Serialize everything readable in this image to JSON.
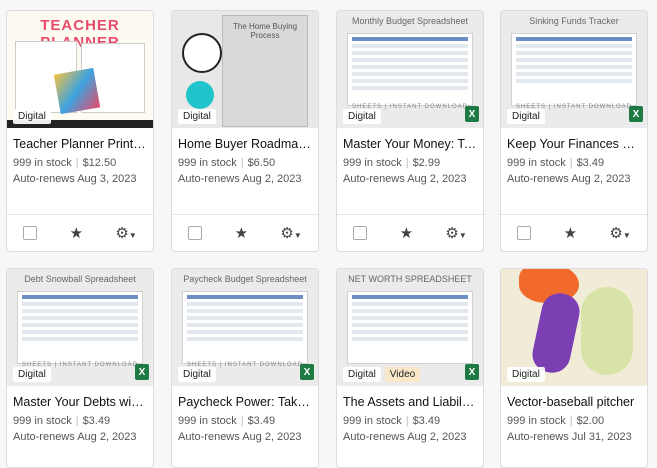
{
  "listings": [
    {
      "title": "Teacher Planner Printa…",
      "stock": "999 in stock",
      "price": "$12.50",
      "renew": "Auto-renews Aug 3, 2023",
      "badges": [
        "Digital"
      ],
      "thumb_text": "TEACHER PLANNER",
      "excel": false
    },
    {
      "title": "Home Buyer Roadmap,…",
      "stock": "999 in stock",
      "price": "$6.50",
      "renew": "Auto-renews Aug 2, 2023",
      "badges": [
        "Digital"
      ],
      "thumb_text": "The Home Buying Process",
      "excel": false
    },
    {
      "title": "Master Your Money: Ta…",
      "stock": "999 in stock",
      "price": "$2.99",
      "renew": "Auto-renews Aug 2, 2023",
      "badges": [
        "Digital"
      ],
      "thumb_text": "Monthly Budget Spreadsheet",
      "excel": true
    },
    {
      "title": "Keep Your Finances on…",
      "stock": "999 in stock",
      "price": "$3.49",
      "renew": "Auto-renews Aug 2, 2023",
      "badges": [
        "Digital"
      ],
      "thumb_text": "Sinking Funds Tracker",
      "excel": true
    },
    {
      "title": "Master Your Debts wit…",
      "stock": "999 in stock",
      "price": "$3.49",
      "renew": "Auto-renews Aug 2, 2023",
      "badges": [
        "Digital"
      ],
      "thumb_text": "Debt Snowball Spreadsheet",
      "excel": true
    },
    {
      "title": "Paycheck Power: Take …",
      "stock": "999 in stock",
      "price": "$3.49",
      "renew": "Auto-renews Aug 2, 2023",
      "badges": [
        "Digital"
      ],
      "thumb_text": "Paycheck Budget Spreadsheet",
      "excel": true
    },
    {
      "title": "The Assets and Liabiliti…",
      "stock": "999 in stock",
      "price": "$3.49",
      "renew": "Auto-renews Aug 2, 2023",
      "badges": [
        "Digital",
        "Video"
      ],
      "thumb_text": "NET WORTH SPREADSHEET",
      "excel": true
    },
    {
      "title": "Vector-baseball pitcher",
      "stock": "999 in stock",
      "price": "$2.00",
      "renew": "Auto-renews Jul 31, 2023",
      "badges": [
        "Digital"
      ],
      "thumb_text": "",
      "excel": false
    }
  ],
  "sheet_footer": "SHEETS | INSTANT DOWNLOAD",
  "excel_icon": "X",
  "icons": {
    "star": "star-icon",
    "gear": "gear-icon",
    "caret": "caret-down-icon",
    "checkbox": "checkbox"
  },
  "colors": {
    "excel": "#1d7a43",
    "badge_video": "#f9e7c8"
  }
}
